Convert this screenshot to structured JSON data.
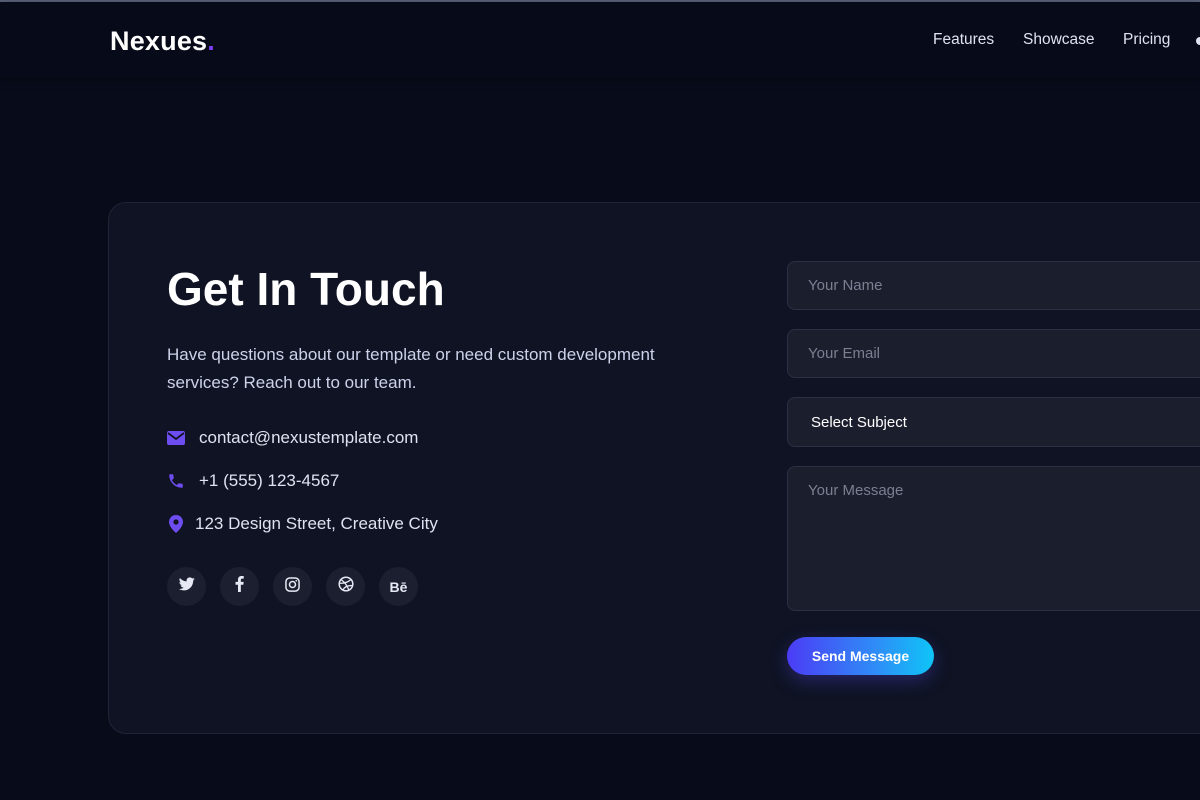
{
  "navbar": {
    "logo_text": "Nexues",
    "logo_dot": ".",
    "links": [
      "Features",
      "Showcase",
      "Pricing"
    ]
  },
  "contact": {
    "title": "Get In Touch",
    "description": "Have questions about our template or need custom development services? Reach out to our team.",
    "email": "contact@nexustemplate.com",
    "phone": "+1 (555) 123-4567",
    "address": "123 Design Street, Creative City",
    "socials": [
      "twitter-icon",
      "facebook-icon",
      "instagram-icon",
      "dribbble-icon",
      "behance-icon"
    ],
    "behance_label": "Bē"
  },
  "form": {
    "name_placeholder": "Your Name",
    "email_placeholder": "Your Email",
    "subject_selected": "Select Subject",
    "message_placeholder": "Your Message",
    "submit_label": "Send Message"
  },
  "colors": {
    "background": "#080b1a",
    "card": "#0f1323",
    "accent": "#7b3ff2",
    "icon_accent": "#6d4df0",
    "button_gradient_start": "#4b3cf5",
    "button_gradient_end": "#0fc4f7"
  }
}
